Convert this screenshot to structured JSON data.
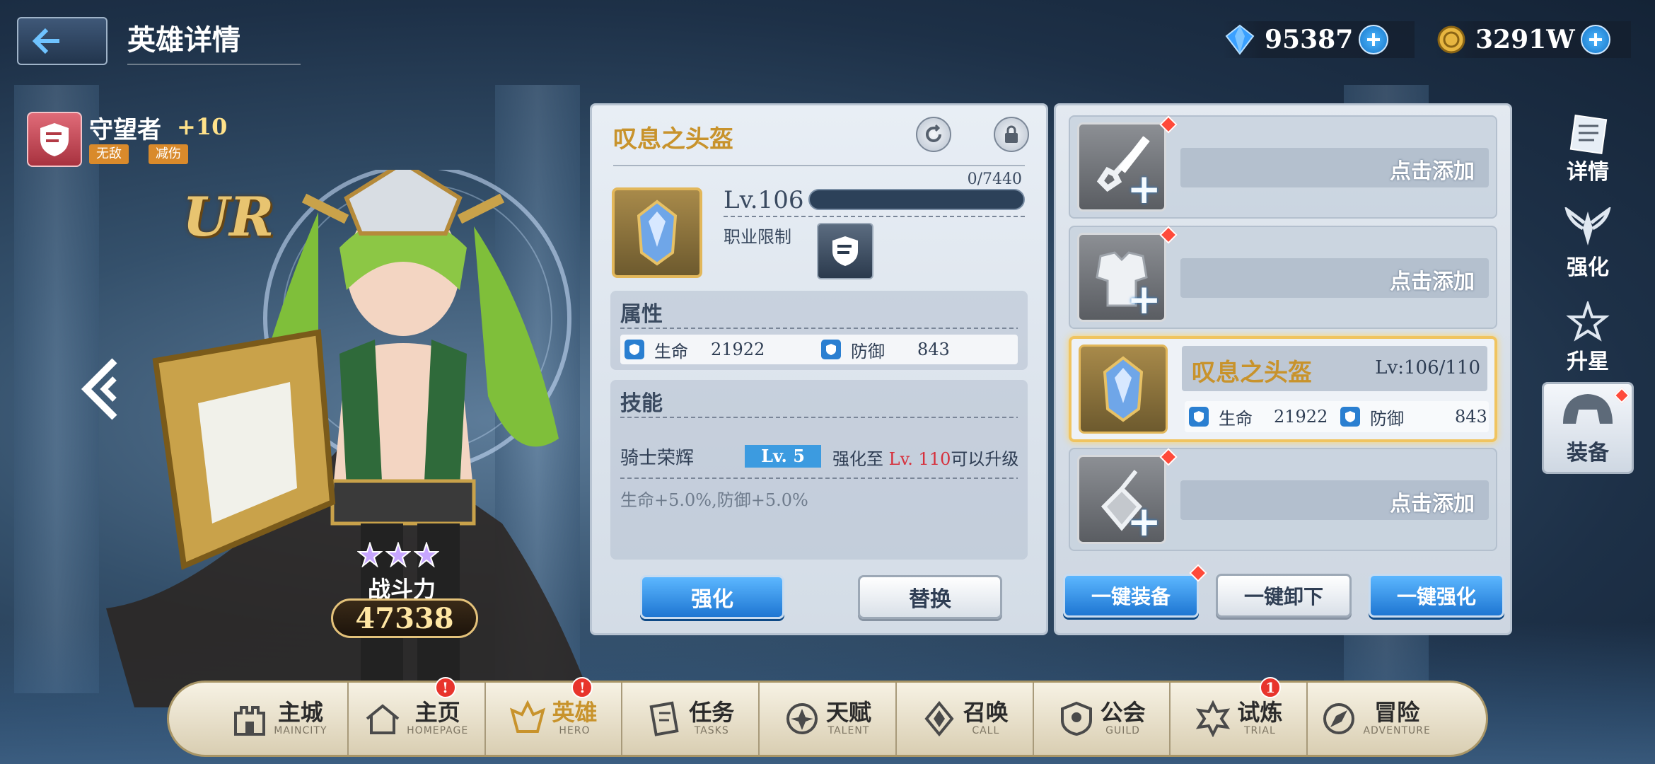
{
  "header": {
    "title": "英雄详情"
  },
  "currencies": [
    {
      "name": "gem",
      "value": "95387"
    },
    {
      "name": "gold",
      "value": "3291W"
    }
  ],
  "hero": {
    "class_name": "守望者",
    "plus": "+10",
    "tags": [
      "无敌",
      "减伤"
    ],
    "rarity": "UR",
    "stars": 3,
    "power_label": "战斗力",
    "power": "47338"
  },
  "item": {
    "name": "叹息之头盔",
    "level": "Lv.106",
    "exp": "0/7440",
    "exp_fraction": 0.0,
    "class_restrict_label": "职业限制",
    "attr_title": "属性",
    "stats": [
      {
        "label": "生命",
        "value": "21922"
      },
      {
        "label": "防御",
        "value": "843"
      }
    ],
    "skill_title": "技能",
    "skill": {
      "name": "骑士荣辉",
      "level": "Lv. 5",
      "req_prefix": "强化至",
      "req_level": "Lv. 110",
      "req_suffix": "可以升级",
      "desc": "生命+5.0%,防御+5.0%"
    },
    "btn_enhance": "强化",
    "btn_replace": "替换"
  },
  "slots": [
    {
      "type": "weapon",
      "add_label": "点击添加"
    },
    {
      "type": "armor",
      "add_label": "点击添加"
    },
    {
      "type": "helmet",
      "name": "叹息之头盔",
      "level": "Lv:106/110",
      "stats": [
        {
          "label": "生命",
          "value": "21922"
        },
        {
          "label": "防御",
          "value": "843"
        }
      ]
    },
    {
      "type": "accessory",
      "add_label": "点击添加"
    }
  ],
  "slot_buttons": {
    "equip_all": "一键装备",
    "unequip_all": "一键卸下",
    "enhance_all": "一键强化"
  },
  "side_tabs": [
    "详情",
    "强化",
    "升星",
    "装备"
  ],
  "bottom_nav": [
    {
      "label": "主城",
      "sub": "MAINCITY",
      "badge": ""
    },
    {
      "label": "主页",
      "sub": "HOMEPAGE",
      "badge": "!"
    },
    {
      "label": "英雄",
      "sub": "HERO",
      "badge": "!"
    },
    {
      "label": "任务",
      "sub": "TASKS",
      "badge": ""
    },
    {
      "label": "天赋",
      "sub": "TALENT",
      "badge": ""
    },
    {
      "label": "召唤",
      "sub": "CALL",
      "badge": ""
    },
    {
      "label": "公会",
      "sub": "GUILD",
      "badge": ""
    },
    {
      "label": "试炼",
      "sub": "TRIAL",
      "badge": "1"
    },
    {
      "label": "冒险",
      "sub": "ADVENTURE",
      "badge": ""
    }
  ],
  "colors": {
    "accent_blue": "#1e76d2",
    "gold_text": "#c8932c",
    "badge_red": "#e8342c"
  }
}
